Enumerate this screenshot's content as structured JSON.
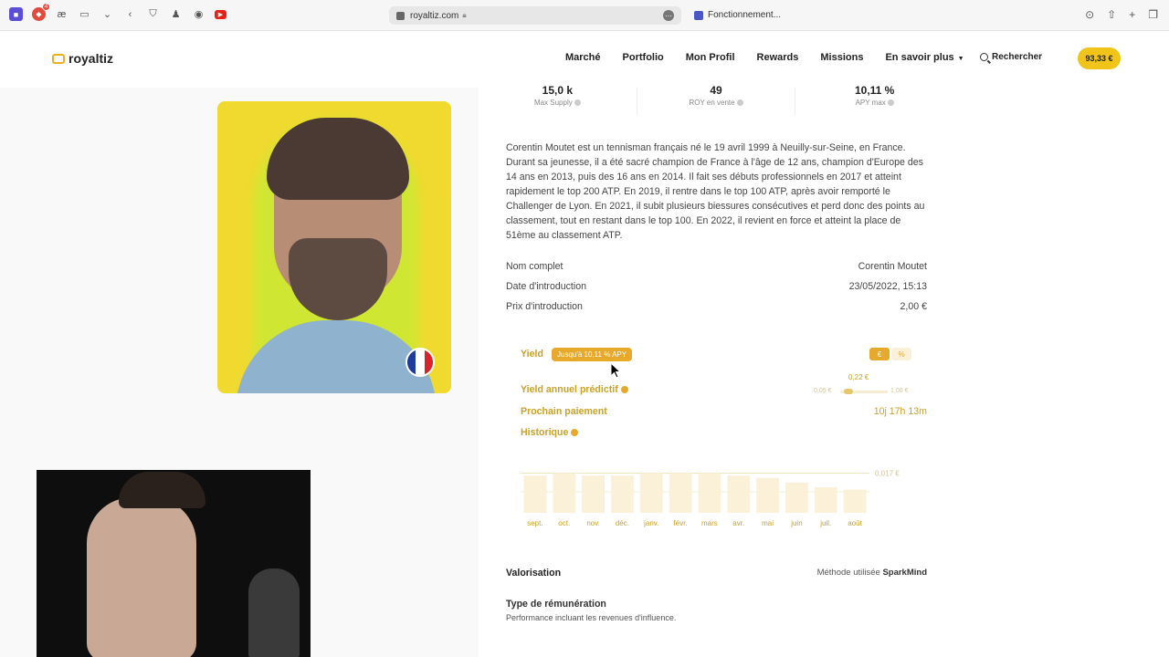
{
  "browser": {
    "url": "royaltiz.com",
    "second_tab": "Fonctionnement...",
    "notification_badge": "4",
    "ext_label": "æ"
  },
  "nav": {
    "logo": "royaltiz",
    "menu": [
      "Marché",
      "Portfolio",
      "Mon Profil",
      "Rewards",
      "Missions",
      "En savoir plus"
    ],
    "search": "Rechercher",
    "balance": "93,33 €"
  },
  "stats": [
    {
      "value": "15,0 k",
      "label": "Max Supply"
    },
    {
      "value": "49",
      "label": "ROY en vente"
    },
    {
      "value": "10,11 %",
      "label": "APY max"
    }
  ],
  "bio": "Corentin Moutet est un tennisman français né le 19 avril 1999 à Neuilly-sur-Seine, en France. Durant sa jeunesse, il a été sacré champion de France à l'âge de 12 ans, champion d'Europe des 14 ans en 2013, puis des 16 ans en 2014. Il fait ses débuts professionnels en 2017 et atteint rapidement le top 200 ATP. En 2019, il rentre dans le top 100 ATP, après avoir remporté le Challenger de Lyon. En 2021, il subit plusieurs biessures consécutives et perd donc des points au classement, tout en restant dans le top 100. En 2022, il revient en force et atteint la place de 51ème au classement ATP.",
  "details": [
    {
      "label": "Nom complet",
      "value": "Corentin Moutet"
    },
    {
      "label": "Date d'introduction",
      "value": "23/05/2022, 15:13"
    },
    {
      "label": "Prix d'introduction",
      "value": "2,00 €"
    }
  ],
  "yield": {
    "label": "Yield",
    "pill": "Jusqu'à 10,11 % APY",
    "toggle_euro": "€",
    "toggle_percent": "%",
    "predictive_label": "Yield annuel prédictif",
    "slider_value": "0,22 €",
    "slider_fraction": 0.18,
    "slider_min": "0,05 €",
    "slider_max": "1,00 €",
    "next_payment_label": "Prochain paiement",
    "next_payment_value": "10j 17h 13m",
    "history_label": "Historique"
  },
  "chart_data": {
    "type": "bar",
    "categories": [
      "sept.",
      "oct.",
      "nov.",
      "déc.",
      "janv.",
      "févr.",
      "mars",
      "avr.",
      "mai",
      "juin",
      "juil.",
      "août"
    ],
    "values": [
      0.016,
      0.017,
      0.016,
      0.016,
      0.017,
      0.017,
      0.017,
      0.016,
      0.015,
      0.013,
      0.011,
      0.01
    ],
    "reference_label": "0,017 €",
    "reference_value": 0.017,
    "ylim": [
      0,
      0.018
    ],
    "color": "#fbf1d9"
  },
  "valorisation": {
    "title": "Valorisation",
    "method_prefix": "Méthode utilisée",
    "method_name": "SparkMind"
  },
  "remuneration": {
    "title": "Type de rémunération",
    "subtitle": "Performance incluant les revenues d'influence."
  },
  "colors": {
    "accent": "#e6a92b",
    "accent_text": "#c9a227",
    "balance": "#f0c419",
    "photo_bg": "#f1da2f"
  }
}
